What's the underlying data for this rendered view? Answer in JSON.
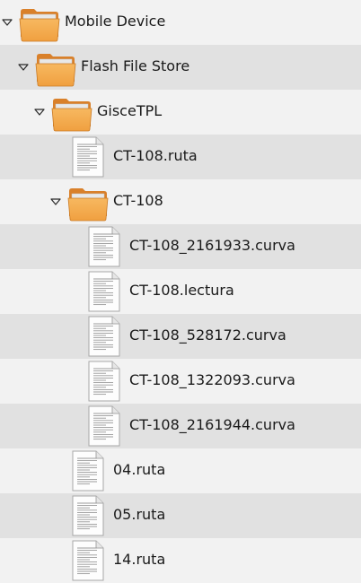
{
  "tree": {
    "rows": [
      {
        "id": "mobile-device",
        "label": "Mobile Device",
        "type": "folder",
        "expanded": true,
        "level": 0
      },
      {
        "id": "flash-file-store",
        "label": "Flash File Store",
        "type": "folder",
        "expanded": true,
        "level": 1
      },
      {
        "id": "gisce-tpl",
        "label": "GisceTPL",
        "type": "folder",
        "expanded": true,
        "level": 2
      },
      {
        "id": "ct-108-ruta",
        "label": "CT-108.ruta",
        "type": "file",
        "level": 3
      },
      {
        "id": "ct-108-folder",
        "label": "CT-108",
        "type": "folder",
        "expanded": true,
        "level": 3
      },
      {
        "id": "ct-108-2161933-curva",
        "label": "CT-108_2161933.curva",
        "type": "file",
        "level": 4
      },
      {
        "id": "ct-108-lectura",
        "label": "CT-108.lectura",
        "type": "file",
        "level": 4
      },
      {
        "id": "ct-108-528172-curva",
        "label": "CT-108_528172.curva",
        "type": "file",
        "level": 4
      },
      {
        "id": "ct-108-1322093-curva",
        "label": "CT-108_1322093.curva",
        "type": "file",
        "level": 4
      },
      {
        "id": "ct-108-2161944-curva",
        "label": "CT-108_2161944.curva",
        "type": "file",
        "level": 4
      },
      {
        "id": "04-ruta",
        "label": "04.ruta",
        "type": "file",
        "level": 3
      },
      {
        "id": "05-ruta",
        "label": "05.ruta",
        "type": "file",
        "level": 3
      },
      {
        "id": "14-ruta",
        "label": "14.ruta",
        "type": "file",
        "level": 3
      }
    ]
  },
  "colors": {
    "row_even": "#f2f2f2",
    "row_odd": "#e1e1e1",
    "folder_body": "#f0a040",
    "folder_back": "#d9802a",
    "folder_tab": "#e8e8e8",
    "text": "#1a1a1a"
  },
  "icons": {
    "expanded": "triangle-down-icon",
    "folder": "folder-icon",
    "file": "text-file-icon"
  }
}
